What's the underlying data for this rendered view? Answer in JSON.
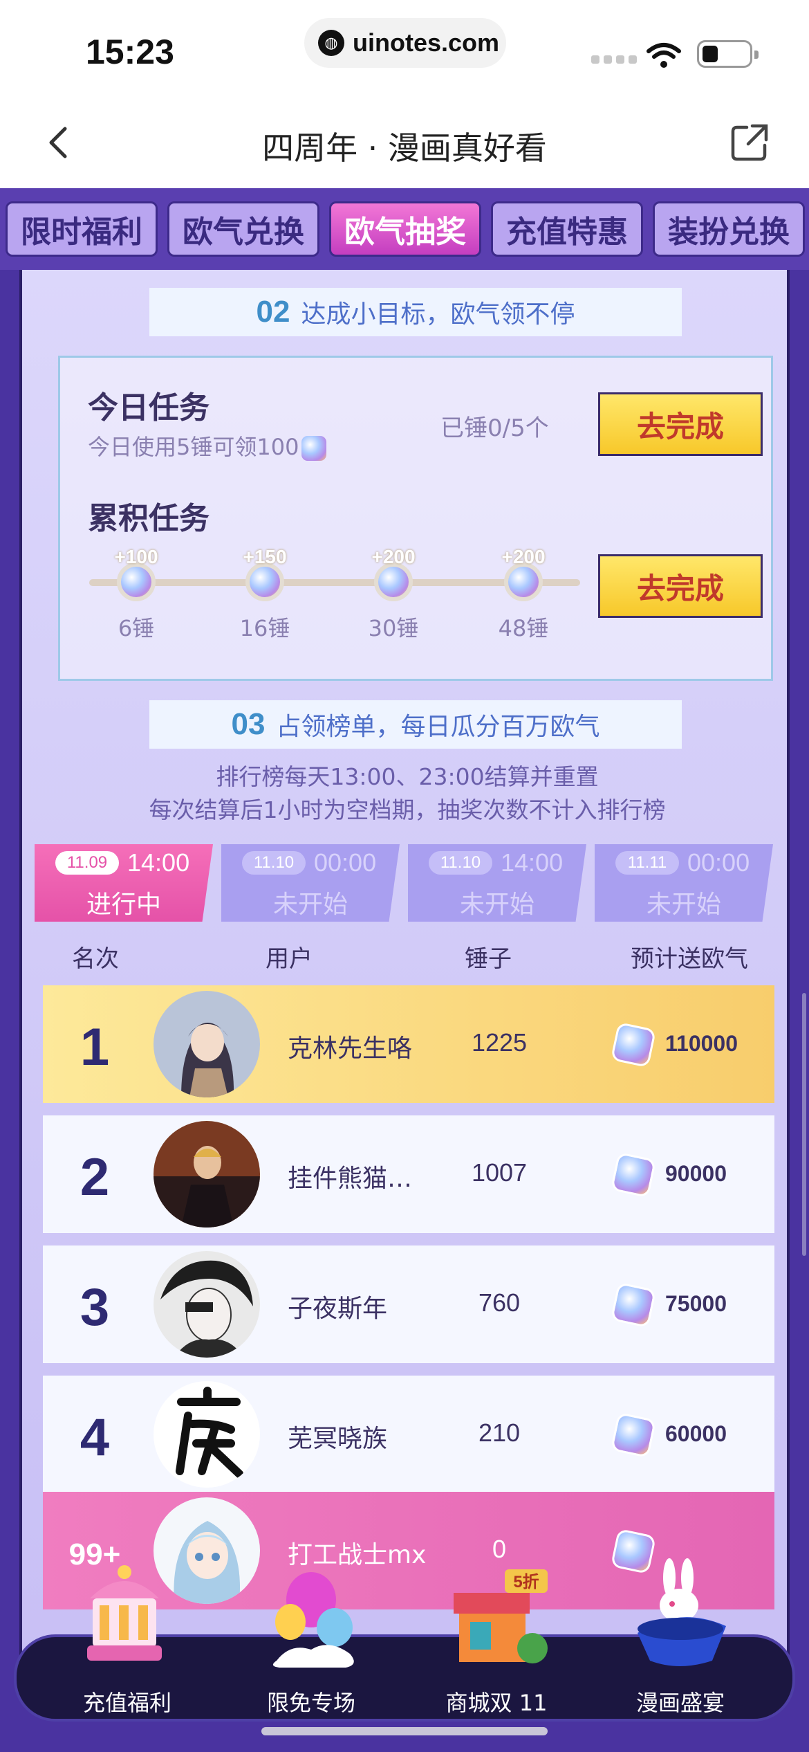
{
  "status": {
    "time": "15:23",
    "url": "uinotes.com"
  },
  "nav": {
    "title": "四周年 · 漫画真好看"
  },
  "tabs": [
    {
      "label": "限时福利",
      "active": false
    },
    {
      "label": "欧气兑换",
      "active": false
    },
    {
      "label": "欧气抽奖",
      "active": true
    },
    {
      "label": "充值特惠",
      "active": false
    },
    {
      "label": "装扮兑换",
      "active": false
    }
  ],
  "section2": {
    "num": "02",
    "title": "达成小目标，欧气领不停",
    "daily": {
      "title": "今日任务",
      "desc": "今日使用5锤可领100",
      "progress": "已锤0/5个",
      "button": "去完成"
    },
    "cumulative": {
      "title": "累积任务",
      "button": "去完成",
      "milestones": [
        {
          "bonus": "+100",
          "label": "6锤"
        },
        {
          "bonus": "+150",
          "label": "16锤"
        },
        {
          "bonus": "+200",
          "label": "30锤"
        },
        {
          "bonus": "+200",
          "label": "48锤"
        }
      ]
    }
  },
  "section3": {
    "num": "03",
    "title": "占领榜单，每日瓜分百万欧气",
    "rule1": "排行榜每天13:00、23:00结算并重置",
    "rule2": "每次结算后1小时为空档期，抽奖次数不计入排行榜",
    "periods": [
      {
        "date": "11.09",
        "time": "14:00",
        "status": "进行中",
        "active": true
      },
      {
        "date": "11.10",
        "time": "00:00",
        "status": "未开始",
        "active": false
      },
      {
        "date": "11.10",
        "time": "14:00",
        "status": "未开始",
        "active": false
      },
      {
        "date": "11.11",
        "time": "00:00",
        "status": "未开始",
        "active": false
      }
    ],
    "columns": {
      "rank": "名次",
      "user": "用户",
      "hammer": "锤子",
      "reward": "预计送欧气"
    },
    "rows": [
      {
        "rank": "1",
        "user": "克林先生咯",
        "hammer": "1225",
        "reward": "110000"
      },
      {
        "rank": "2",
        "user": "挂件熊猫…",
        "hammer": "1007",
        "reward": "90000"
      },
      {
        "rank": "3",
        "user": "子夜斯年",
        "hammer": "760",
        "reward": "75000"
      },
      {
        "rank": "4",
        "user": "芜冥晓族",
        "hammer": "210",
        "reward": "60000"
      }
    ],
    "me": {
      "rank": "99+",
      "user": "打工战士mx",
      "hammer": "0",
      "reward": ""
    }
  },
  "bottom_nav": [
    {
      "label": "充值福利",
      "icon": "carousel-icon"
    },
    {
      "label": "限免专场",
      "icon": "balloon-icon"
    },
    {
      "label": "商城双 11",
      "icon": "shop-stall-icon",
      "badge": "5折"
    },
    {
      "label": "漫画盛宴",
      "icon": "magic-hat-rabbit-icon"
    }
  ],
  "colors": {
    "accent": "#e552a8",
    "tabbar": "#5a3fb0",
    "panel": "#dcd7fb",
    "button": "#f7c82a"
  }
}
